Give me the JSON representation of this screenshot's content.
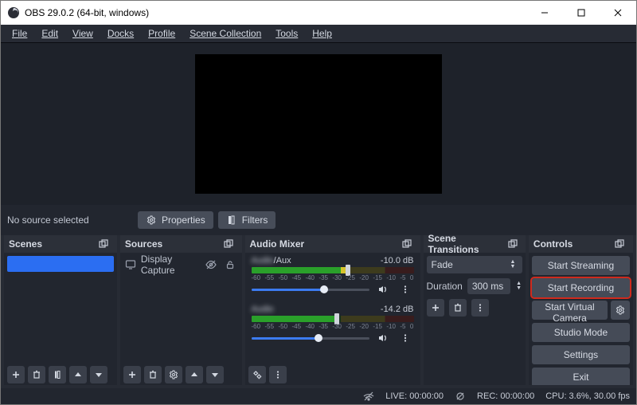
{
  "titlebar": {
    "title": "OBS 29.0.2 (64-bit, windows)"
  },
  "menu": {
    "file": "File",
    "edit": "Edit",
    "view": "View",
    "docks": "Docks",
    "profile": "Profile",
    "scene_collection": "Scene Collection",
    "tools": "Tools",
    "help": "Help"
  },
  "underbar": {
    "no_source": "No source selected",
    "properties": "Properties",
    "filters": "Filters"
  },
  "docks": {
    "scenes": {
      "title": "Scenes",
      "items": [
        {
          "label": ""
        }
      ]
    },
    "sources": {
      "title": "Sources",
      "items": [
        {
          "label": "Display Capture"
        }
      ]
    },
    "mixer": {
      "title": "Audio Mixer",
      "ticks": [
        "-60",
        "-55",
        "-50",
        "-45",
        "-40",
        "-35",
        "-30",
        "-25",
        "-20",
        "-15",
        "-10",
        "-5",
        "0"
      ],
      "channels": [
        {
          "name_blur_prefix": "",
          "name_tail": "/Aux",
          "db": "-10.0 dB",
          "meter_cover_pct": 42,
          "slider_pct": 62
        },
        {
          "name_blur_prefix": "",
          "name_tail": "",
          "db": "-14.2 dB",
          "meter_cover_pct": 49,
          "slider_pct": 57
        }
      ]
    },
    "transitions": {
      "title": "Scene Transitions",
      "selected": "Fade",
      "duration_label": "Duration",
      "duration_value": "300 ms"
    },
    "controls": {
      "title": "Controls",
      "start_streaming": "Start Streaming",
      "start_recording": "Start Recording",
      "start_vcam": "Start Virtual Camera",
      "studio_mode": "Studio Mode",
      "settings": "Settings",
      "exit": "Exit"
    }
  },
  "status": {
    "live_label": "LIVE:",
    "live_time": "00:00:00",
    "rec_label": "REC:",
    "rec_time": "00:00:00",
    "cpu": "CPU: 3.6%, 30.00 fps"
  }
}
